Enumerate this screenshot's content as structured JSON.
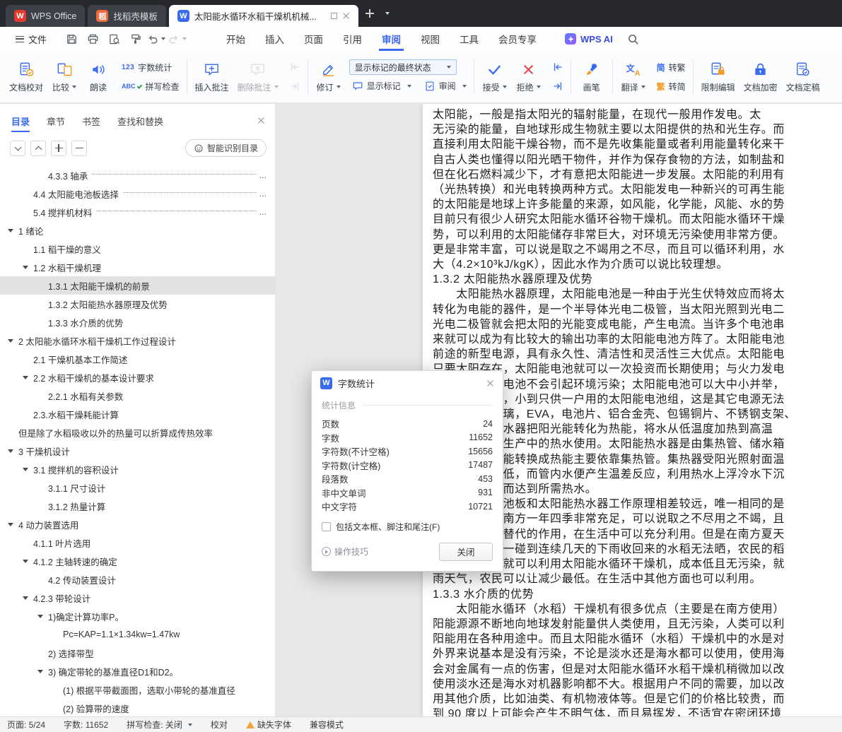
{
  "colors": {
    "accent": "#3a6af0",
    "danger": "#e5484d",
    "tabbar_bg": "#26282d",
    "selected_bg": "#e2e2e2"
  },
  "icons": {
    "wps_logo": "W",
    "docer_glyph": "稻",
    "doc_glyph": "W",
    "dialog_logo": "W",
    "abc": "ABC",
    "num123": "123",
    "jian": "简",
    "fan": "繁",
    "wen": "文",
    "a": "A"
  },
  "tabbar": {
    "home_label": "WPS Office",
    "docer_label": "找稻壳模板",
    "doc_label": "太阳能水循环水稻干燥机机械..."
  },
  "menubar": {
    "file_label": "文件",
    "items": [
      "开始",
      "插入",
      "页面",
      "引用",
      "审阅",
      "视图",
      "工具",
      "会员专享"
    ],
    "active_index": 4,
    "wps_ai_label": "WPS AI"
  },
  "ribbon": {
    "doc_proof": "文档校对",
    "compare": "比较",
    "read_aloud": "朗读",
    "word_count": "字数统计",
    "spell_check": "拼写检查",
    "insert_comment": "插入批注",
    "delete_comment": "删除批注",
    "track_changes": "修订",
    "markup_state": "显示标记的最终状态",
    "show_markup": "显示标记",
    "review": "审阅",
    "accept": "接受",
    "reject": "拒绝",
    "pen": "画笔",
    "translate": "翻译",
    "to_trad": "转繁",
    "to_simp": "转简",
    "restrict_edit": "限制编辑",
    "doc_encrypt": "文档加密",
    "doc_finalize": "文档定稿"
  },
  "sidebar": {
    "tabs": [
      "目录",
      "章节",
      "书签",
      "查找和替换"
    ],
    "active_tab_index": 0,
    "smart_button": "智能识别目录",
    "leader_tail": "...",
    "toc": [
      {
        "text": "4.3.3  轴承",
        "level": 2,
        "leader": true
      },
      {
        "text": "4.4  太阳能电池板选择",
        "level": 1,
        "leader": true
      },
      {
        "text": "5.4  搅拌机材料",
        "level": 1,
        "leader": true
      },
      {
        "text": "1  绪论",
        "level": 0,
        "expand": true
      },
      {
        "text": "1.1  稻干燥的意义",
        "level": 1
      },
      {
        "text": "1.2  水稻干燥机理",
        "level": 1,
        "expand": true
      },
      {
        "text": "1.3.1  太阳能干燥机的前景",
        "level": 2,
        "selected": true
      },
      {
        "text": "1.3.2  太阳能热水器原理及优势",
        "level": 2
      },
      {
        "text": "1.3.3  水介质的优势",
        "level": 2
      },
      {
        "text": "2  太阳能水循环水稻干燥机工作过程设计",
        "level": 0,
        "expand": true
      },
      {
        "text": "2.1  干燥机基本工作简述",
        "level": 1
      },
      {
        "text": "2.2  水稻干燥机的基本设计要求",
        "level": 1,
        "expand": true
      },
      {
        "text": "2.2.1  水稻有关参数",
        "level": 2
      },
      {
        "text": "2.3.水稻干燥耗能计算",
        "level": 1
      },
      {
        "text": "但是除了水稻吸收以外的热量可以折算成传热效率",
        "level": 0
      },
      {
        "text": "3  干燥机设计",
        "level": 0,
        "expand": true
      },
      {
        "text": "3.1  搅拌机的容积设计",
        "level": 1,
        "expand": true
      },
      {
        "text": "3.1.1  尺寸设计",
        "level": 2
      },
      {
        "text": "3.1.2  热量计算",
        "level": 2
      },
      {
        "text": "4  动力装置选用",
        "level": 0,
        "expand": true
      },
      {
        "text": "4.1.1  叶片选用",
        "level": 1
      },
      {
        "text": "4.1.2  主轴转速的确定",
        "level": 1,
        "expand": true
      },
      {
        "text": "4.2  传动装置设计",
        "level": 2
      },
      {
        "text": "4.2.3  带轮设计",
        "level": 1,
        "expand": true
      },
      {
        "text": "1)确定计算功率P。",
        "level": 2,
        "expand": true
      },
      {
        "text": "Pc=KAP=1.1×1.34kw=1.47kw",
        "level": 3
      },
      {
        "text": "2) 选择带型",
        "level": 2
      },
      {
        "text": "3) 确定带轮的基准直径D1和D2。",
        "level": 2,
        "expand": true
      },
      {
        "text": "(1) 根据平带截面图，选取小带轮的基准直径",
        "level": 3
      },
      {
        "text": "(2) 验算带的速度",
        "level": 3
      }
    ]
  },
  "document": {
    "lines": [
      "太阳能，一般是指太阳光的辐射能量，在现代一般用作发电。太",
      "无污染的能量，自地球形成生物就主要以太阳提供的热和光生存。而",
      "直接利用太阳能干燥谷物，而不是先收集能量或者利用能量转化来干",
      "自古人类也懂得以阳光晒干物件，并作为保存食物的方法，如制盐和",
      "但在化石燃料减少下，才有意把太阳能进一步发展。太阳能的利用有",
      "（光热转换）和光电转换两种方式。太阳能发电一种新兴的可再生能",
      "的太阳能是地球上许多能量的来源，如风能，化学能，风能、水的势",
      "目前只有很少人研究太阳能水循环谷物干燥机。而太阳能水循环干燥",
      "势，可以利用的太阳能储存非常巨大，对环境无污染使用非常方便。",
      "更是非常丰富，可以说是取之不竭用之不尽，而且可以循环利用，水",
      "大（4.2×10³kJ/kgK），因此水作为介质可以说比较理想。",
      "1.3.2 太阳能热水器原理及优势",
      "　　太阳能热水器原理，太阳能电池是一种由于光生伏特效应而将太",
      "转化为电能的器件，是一个半导体光电二极管，当太阳光照到光电二",
      "光电二极管就会把太阳的光能变成电能，产生电流。当许多个电池串",
      "来就可以成为有比较大的输出功率的太阳能电池方阵了。太阳能电池",
      "前途的新型电源，具有永久性、清洁性和灵活性三大优点。太阳能电",
      "只要太阳存在，太阳能电池就可以一次投资而长期使用；与火力发电",
      "相比，太阳能电池不会引起环境污染；太阳能电池可以大中小并举，",
      "瓦的中型电站，小到只供一户用的太阳能电池组，这是其它电源无法",
      "池板原料：玻璃，EVA，电池片、铝合金壳、包锡铜片、不锈钢支架、",
      "　　太阳能热水器把阳光能转化为热能，将水从低温度加热到高温",
      "人们在生活、生产中的热水使用。太阳能热水器是由集热管、储水箱",
      "组成，把太阳能转换成热能主要依靠集热管。集热器受阳光照射面温",
      "管背阳面温度低，而管内水便产生温差反应，利用热水上浮冷水下沉",
      "水产生微循环而达到所需热水。",
      "　　太阳能电池板和太阳能热水器工作原理相差较远，唯一相同的是",
      "能，太阳能在南方一年四季非常充足，可以说取之不尽用之不竭，且",
      "农村有着不可替代的作用，在生活中可以充分利用。但是在南方夏天",
      "收割水稻时万一碰到连续几天的下雨收回来的水稻无法晒，农民的稻",
      "大，这样他们就可以利用太阳能水循环干燥机，成本低且无污染，就",
      "雨天气，农民可以让减少最低。在生活中其他方面也可以利用。",
      "1.3.3 水介质的优势",
      "　　太阳能水循环（水稻）干燥机有很多优点（主要是在南方使用）",
      "阳能源源不断地向地球发射能量供人类使用，且无污染，人类可以利",
      "阳能用在各种用途中。而且太阳能水循环（水稻）干燥机中的水是对",
      "外界来说基本是没有污染，不论是淡水还是海水都可以使用，使用海",
      "会对金属有一点的伤害，但是对太阳能水循环水稻干燥机稍微加以改",
      "使用淡水还是海水对机器影响都不大。根据用户不同的需要，加以改",
      "用其他介质，比如油类、有机物液体等。但是它们的价格比较贵，而",
      "到 90 度以上可能会产生不明气体，而且易挥发，不适宜在密闭环境"
    ]
  },
  "dialog": {
    "title": "字数统计",
    "section": "统计信息",
    "stats": [
      {
        "label": "页数",
        "value": "24"
      },
      {
        "label": "字数",
        "value": "11652"
      },
      {
        "label": "字符数(不计空格)",
        "value": "15656"
      },
      {
        "label": "字符数(计空格)",
        "value": "17487"
      },
      {
        "label": "段落数",
        "value": "453"
      },
      {
        "label": "非中文单词",
        "value": "931"
      },
      {
        "label": "中文字符",
        "value": "10721"
      }
    ],
    "checkbox_label": "包括文本框、脚注和尾注(F)",
    "tips_label": "操作技巧",
    "close_label": "关闭"
  },
  "statusbar": {
    "page": "页面: 5/24",
    "words": "字数: 11652",
    "spell": "拼写检查: 关闭",
    "proof": "校对",
    "missing_font": "缺失字体",
    "compat": "兼容模式"
  }
}
